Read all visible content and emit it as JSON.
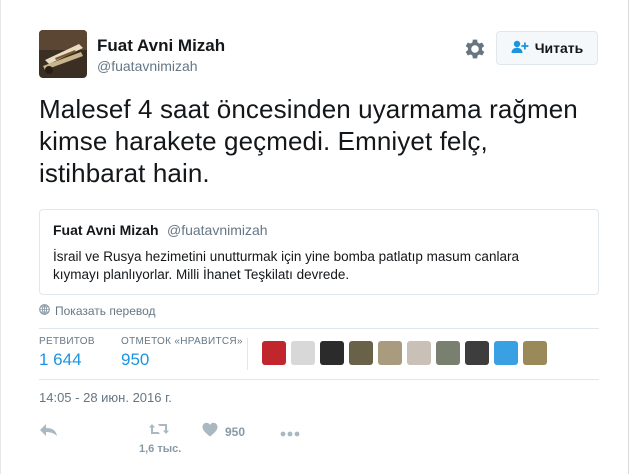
{
  "author": {
    "name": "Fuat Avni Mizah",
    "handle": "@fuatavnimizah"
  },
  "follow_button": {
    "label": "Читать",
    "icon": "add-user-icon"
  },
  "settings_icon": "gear-icon",
  "tweet": {
    "lines": [
      "Malesef 4 saat öncesinden uyarmama rağmen",
      "kimse harakete geçmedi. Emniyet felç,",
      "istihbarat hain."
    ]
  },
  "quoted_tweet": {
    "name": "Fuat Avni Mizah",
    "handle": "@fuatavnimizah",
    "lines": [
      "İsrail ve Rusya hezimetini unutturmak için yine bomba patlatıp masum canlara",
      "kıymayı planlıyorlar. Milli İhanet Teşkilatı devrede."
    ]
  },
  "translate_link": {
    "label": "Показать перевод",
    "icon": "globe-icon"
  },
  "stats": {
    "retweets_label": "РЕТВИТОВ",
    "retweets_value": "1 644",
    "likes_label": "ОТМЕТОК «НРАВИТСЯ»",
    "likes_value": "950"
  },
  "likers": [
    {
      "name": "liker-avatar-1",
      "color": "#c0262c"
    },
    {
      "name": "liker-avatar-2",
      "color": "#d8d8d8"
    },
    {
      "name": "liker-avatar-3",
      "color": "#2b2b2b"
    },
    {
      "name": "liker-avatar-4",
      "color": "#6a6248"
    },
    {
      "name": "liker-avatar-5",
      "color": "#a99b7e"
    },
    {
      "name": "liker-avatar-6",
      "color": "#c9c1b8"
    },
    {
      "name": "liker-avatar-7",
      "color": "#7a8070"
    },
    {
      "name": "liker-avatar-8",
      "color": "#3d3d3d"
    },
    {
      "name": "liker-avatar-9",
      "color": "#3aa0e4"
    },
    {
      "name": "liker-avatar-10",
      "color": "#9a8a5a"
    }
  ],
  "timestamp": "14:05 - 28 июн. 2016 г.",
  "actions": {
    "reply_icon": "reply-icon",
    "retweet_icon": "retweet-icon",
    "retweet_sub_count": "1,6 тыс.",
    "like_icon": "heart-icon",
    "like_count": "950",
    "more_icon": "more-icon"
  },
  "colors": {
    "link_blue": "#1b95e0",
    "muted": "#657786",
    "border": "#e1e8ed"
  }
}
